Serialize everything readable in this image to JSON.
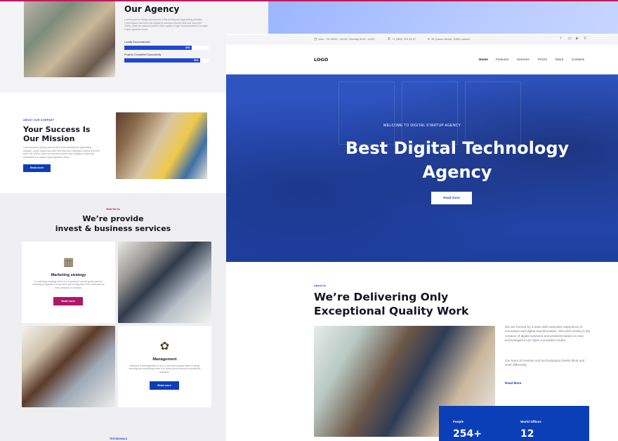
{
  "left": {
    "agency": {
      "title": "Our Agency",
      "paragraph": "Lorem ipsum is simply dummy text of the printing and typesetting industry. Lorem Ipsum has been the industry's standard dummy text ever since the 1500s, when an unknown printer took a galley of type and scrambled it to make a type specimen book.",
      "bars": [
        {
          "label": "Locally Recommended",
          "percent": 80,
          "percent_text": "80%"
        },
        {
          "label": "Projects Completed Successfully",
          "percent": 90,
          "percent_text": "90%"
        }
      ]
    },
    "mission": {
      "kicker": "ABOUT OUR COMPANY",
      "title": "Your Success Is Our Mission",
      "paragraph": "Lorem ipsum is simply dummy text of the printing and typesetting industry. Lorem Ipsum has been the industry's standard dummy text ever since the 1500s, when an unknown printer took a galley of type and scrambled it to make a type specimen book.",
      "button": "Read more"
    },
    "services": {
      "kicker": "What We Do",
      "title_line1": "We’re provide",
      "title_line2": "invest & business services",
      "card1": {
        "icon": "marketing-icon",
        "title": "Marketing strategy",
        "text": "A marketing strategy refers to a business's overall game plan for reaching prospective consumers and turning them into customers of their products or services.",
        "button": "Read more"
      },
      "card2": {
        "icon": "management-icon",
        "title": "Management",
        "text": "Business & Management is one of the most popular fields of study, teaching you everything there is to know about running a successful business.",
        "button": "Read more"
      }
    },
    "bottom_label": "TESTIMONIALS"
  },
  "right": {
    "infobar": {
      "hours": "Mon - Fri 09:00 - 18:00 / Sunday 8:00 - 14:00",
      "phone": "+1 (560) 123 45 67",
      "address": "45 Queen Street, 2050 London",
      "social_icons": [
        "facebook-icon",
        "instagram-icon",
        "youtube-icon",
        "whatsapp-icon"
      ]
    },
    "nav": {
      "logo": "LOGO",
      "items": [
        "Home",
        "Features",
        "Services",
        "Prices",
        "About",
        "Contacts"
      ],
      "active": "Home"
    },
    "hero": {
      "kicker": "WELCOME TO DIGITAL STARTUP AGENCY",
      "title": "Best Digital Technology Agency",
      "button": "Read more"
    },
    "about": {
      "kicker": "About Us",
      "title_line1": "We’re Delivering Only",
      "title_line2": "Exceptional Quality Work",
      "paragraph1": "We are formed by a team with extensive experience in innovation and digital transformation. We work mainly in the creation of digital solutions and products based on new technologies in an Open Innovation model.",
      "paragraph2": "Our team of creative and technological Geeks think and work differently.",
      "read_more": "Read More"
    },
    "stats": [
      {
        "label": "People",
        "value": "254+"
      },
      {
        "label": "World Offices",
        "value": "12"
      }
    ]
  },
  "colors": {
    "accent_blue": "#1f46d6",
    "button_blue": "#0b3fb8",
    "accent_pink": "#b0166b"
  }
}
